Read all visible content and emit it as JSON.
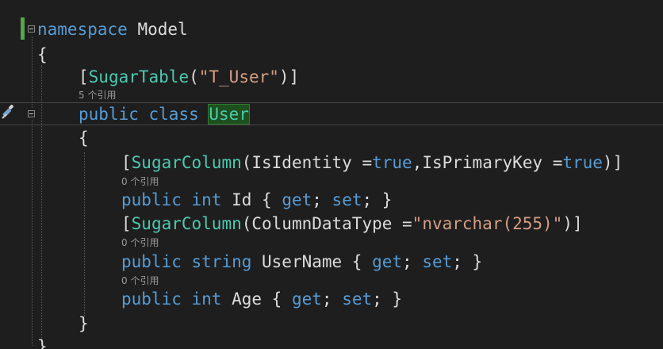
{
  "code": {
    "l1_kw": "namespace",
    "l1_name": " Model",
    "l2": "{",
    "l3_open": "[",
    "l3_attr": "SugarTable",
    "l3_p1": "(",
    "l3_str": "\"T_User\"",
    "l3_p2": ")]",
    "lens1": "5 个引用",
    "l4_kw1": "public",
    "l4_kw2": "class",
    "l4_name": "User",
    "l5": "{",
    "l6_open": "[",
    "l6_attr": "SugarColumn",
    "l6_a": "(IsIdentity =",
    "l6_true1": "true",
    "l6_b": ",IsPrimaryKey =",
    "l6_true2": "true",
    "l6_c": ")]",
    "lens2": "0 个引用",
    "l7_public": "public",
    "l7_int": "int",
    "l7_name": " Id { ",
    "l7_get": "get",
    "l7_sep": "; ",
    "l7_set": "set",
    "l7_end": "; }",
    "l8_open": "[",
    "l8_attr": "SugarColumn",
    "l8_a": "(ColumnDataType =",
    "l8_str": "\"nvarchar(255)\"",
    "l8_end": ")]",
    "lens3": "0 个引用",
    "l9_public": "public",
    "l9_string": "string",
    "l9_name": " UserName { ",
    "l9_get": "get",
    "l9_sep": "; ",
    "l9_set": "set",
    "l9_end": "; }",
    "lens4": "0 个引用",
    "l10_public": "public",
    "l10_int": "int",
    "l10_name": " Age { ",
    "l10_get": "get",
    "l10_sep": "; ",
    "l10_set": "set",
    "l10_end": "; }",
    "l11": "}",
    "l12": "}"
  },
  "colors": {
    "keyword": "#569cd6",
    "type": "#4ec9b0",
    "string": "#d69d85",
    "text": "#dcdcdc",
    "codelens": "#999999",
    "background": "#1e1e1e"
  },
  "icons": [
    "collapse-icon",
    "quick-action-brush-icon"
  ]
}
